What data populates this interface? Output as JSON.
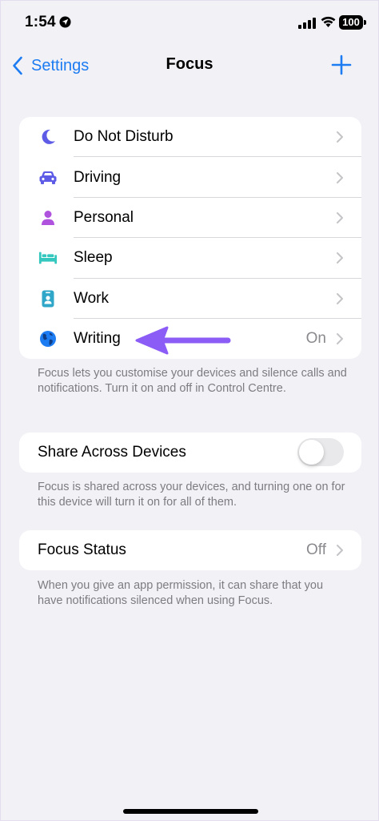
{
  "status_bar": {
    "time": "1:54",
    "battery": "100"
  },
  "nav": {
    "back_label": "Settings",
    "title": "Focus"
  },
  "focus_modes": [
    {
      "label": "Do Not Disturb",
      "icon": "moon-icon",
      "color": "#5e5ce6",
      "value": ""
    },
    {
      "label": "Driving",
      "icon": "car-icon",
      "color": "#5e5ce6",
      "value": ""
    },
    {
      "label": "Personal",
      "icon": "person-icon",
      "color": "#af52de",
      "value": ""
    },
    {
      "label": "Sleep",
      "icon": "bed-icon",
      "color": "#34c7be",
      "value": ""
    },
    {
      "label": "Work",
      "icon": "badge-icon",
      "color": "#30a7c9",
      "value": ""
    },
    {
      "label": "Writing",
      "icon": "globe-icon",
      "color": "#1d7cf2",
      "value": "On"
    }
  ],
  "focus_footnote": "Focus lets you customise your devices and silence calls and notifications. Turn it on and off in Control Centre.",
  "share_across_devices": {
    "label": "Share Across Devices",
    "enabled": false,
    "footnote": "Focus is shared across your devices, and turning one on for this device will turn it on for all of them."
  },
  "focus_status": {
    "label": "Focus Status",
    "value": "Off",
    "footnote": "When you give an app permission, it can share that you have notifications silenced when using Focus."
  },
  "colors": {
    "accent": "#1d7cf2",
    "annotation_arrow": "#8b5cf6"
  }
}
